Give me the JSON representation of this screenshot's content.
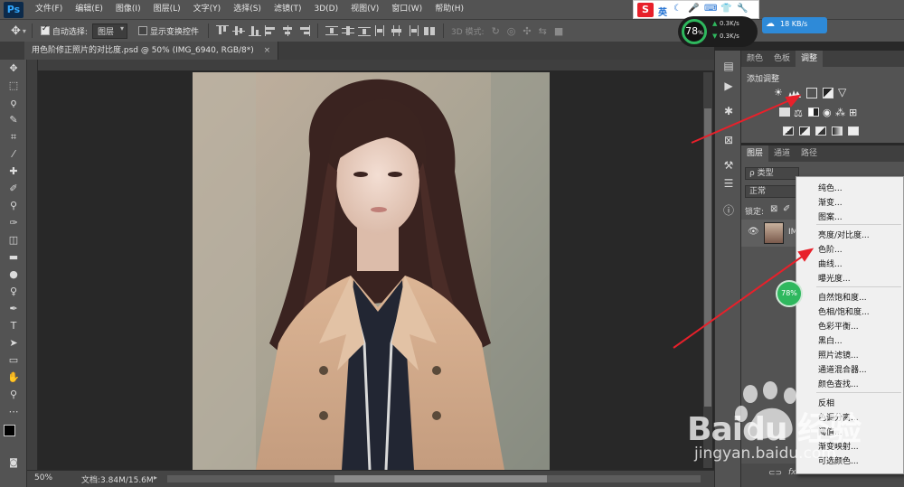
{
  "app": {
    "logo": "Ps"
  },
  "menubar": {
    "items": [
      "文件(F)",
      "编辑(E)",
      "图像(I)",
      "图层(L)",
      "文字(Y)",
      "选择(S)",
      "滤镜(T)",
      "3D(D)",
      "视图(V)",
      "窗口(W)",
      "帮助(H)"
    ]
  },
  "options": {
    "auto_select_label": "自动选择:",
    "auto_select_value": "图层",
    "show_transform_label": "显示变换控件",
    "mode_3d_label": "3D 模式:"
  },
  "document": {
    "tab_title": "用色阶修正照片的对比度.psd @ 50% (IMG_6940, RGB/8*)",
    "close_glyph": "×"
  },
  "status": {
    "zoom": "50%",
    "doc_info": "文档:3.84M/15.6M"
  },
  "adjust_panel": {
    "tabs": [
      "颜色",
      "色板",
      "调整"
    ],
    "active_tab": "调整",
    "heading": "添加调整"
  },
  "layers_panel": {
    "tabs": [
      "图层",
      "通道",
      "路径"
    ],
    "active_tab": "图层",
    "filter_label": "ρ 类型",
    "blend_mode": "正常",
    "lock_label": "锁定:",
    "layer_name_fragment": "IM"
  },
  "context_menu": {
    "groups": [
      [
        "纯色...",
        "渐变...",
        "图案..."
      ],
      [
        "亮度/对比度...",
        "色阶...",
        "曲线...",
        "曝光度..."
      ],
      [
        "自然饱和度...",
        "色相/饱和度...",
        "色彩平衡...",
        "黑白...",
        "照片滤镜...",
        "通道混合器...",
        "颜色查找..."
      ],
      [
        "反相",
        "色调分离...",
        "阈值...",
        "渐变映射...",
        "可选颜色..."
      ]
    ]
  },
  "system_overlays": {
    "ime_label": "英",
    "net_percent": "78",
    "net_percent_unit": "%",
    "up_speed": "0.3K/s",
    "down_speed": "0.3K/s",
    "cloud_speed": "18 KB/s",
    "float_badge": "78%"
  },
  "watermark": {
    "brand": "Baidu 经验",
    "url": "jingyan.baidu.com"
  },
  "colors": {
    "ui_gray": "#535353",
    "ui_dark": "#3c3c3c",
    "canvas_bg": "#282828",
    "arrow_red": "#e8202a",
    "ps_blue": "#31a8ff",
    "badge_green": "#2fb85e"
  }
}
